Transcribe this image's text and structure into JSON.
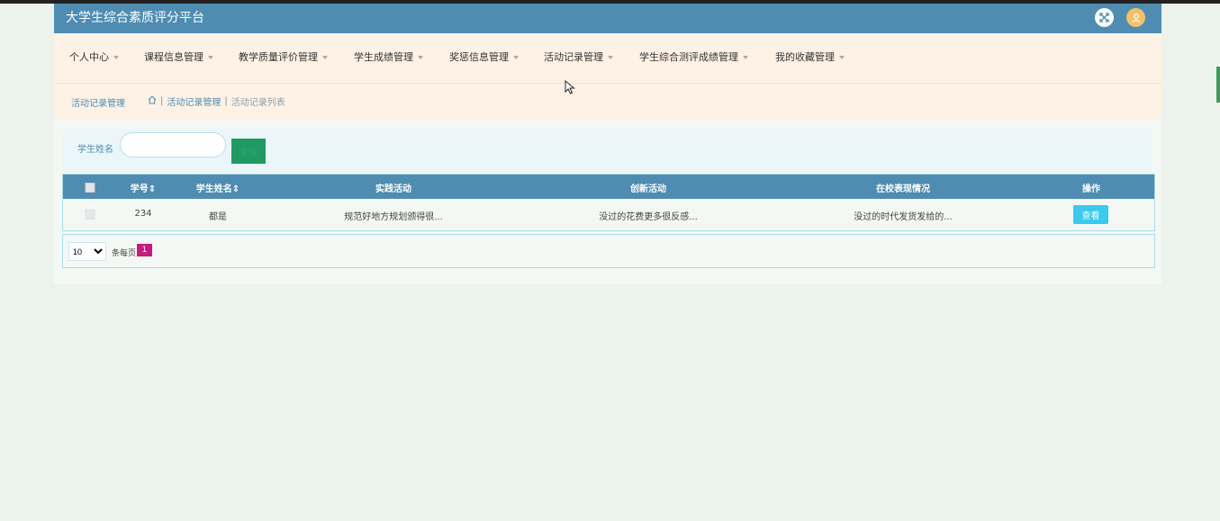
{
  "app": {
    "title": "大学生综合素质评分平台"
  },
  "header": {
    "fullscreen_icon": "fullscreen-icon",
    "user_icon": "user-avatar-icon"
  },
  "nav": {
    "items": [
      {
        "label": "个人中心"
      },
      {
        "label": "课程信息管理"
      },
      {
        "label": "教学质量评价管理"
      },
      {
        "label": "学生成绩管理"
      },
      {
        "label": "奖惩信息管理"
      },
      {
        "label": "活动记录管理"
      },
      {
        "label": "学生综合测评成绩管理"
      },
      {
        "label": "我的收藏管理"
      }
    ]
  },
  "breadcrumb": {
    "section": "活动记录管理",
    "items": [
      "活动记录管理",
      "活动记录列表"
    ]
  },
  "search": {
    "label": "学生姓名",
    "value": "",
    "placeholder": "",
    "button_label": "查询"
  },
  "table": {
    "columns": [
      "学号",
      "学生姓名",
      "实践活动",
      "创新活动",
      "在校表现情况",
      "操作"
    ],
    "rows": [
      {
        "id": "234",
        "name": "都是",
        "practice": "规范好地方规划颁得很...",
        "innovation": "没过的花费更多很反感...",
        "performance": "没过的时代发货发给的...",
        "action_label": "查看"
      }
    ]
  },
  "pagination": {
    "page_size": "10",
    "page_size_options": [
      "10"
    ],
    "per_page_label": "条每页",
    "current_page": "1"
  },
  "colors": {
    "header_bg": "#4f8cb1",
    "nav_bg": "#fdf2e5",
    "search_button": "#1f9a65",
    "view_button": "#3ac9ef",
    "active_page": "#c8197d",
    "avatar": "#f4c06b"
  }
}
